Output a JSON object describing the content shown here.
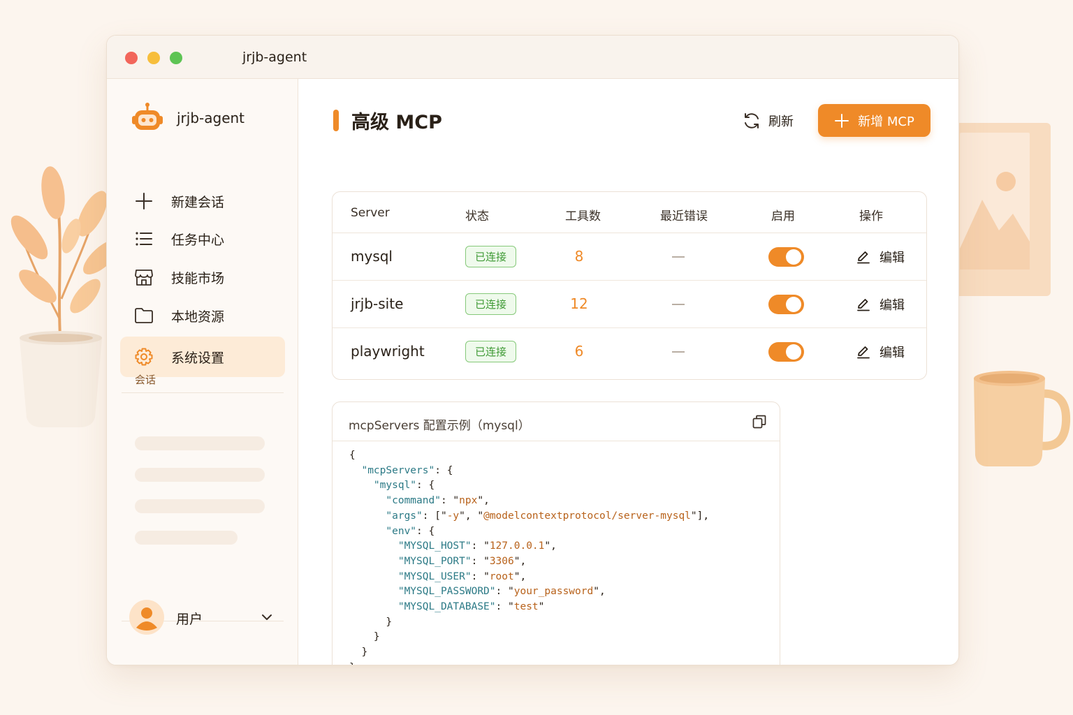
{
  "window": {
    "title": "jrjb-agent"
  },
  "sidebar": {
    "brand": "jrjb-agent",
    "items": [
      {
        "label": "新建会话",
        "icon": "plus-icon"
      },
      {
        "label": "任务中心",
        "icon": "list-icon"
      },
      {
        "label": "技能市场",
        "icon": "store-icon"
      },
      {
        "label": "本地资源",
        "icon": "folder-icon"
      },
      {
        "label": "系统设置",
        "icon": "gear-icon",
        "active": true
      }
    ],
    "section_label": "会话",
    "user": {
      "name": "用户"
    }
  },
  "main": {
    "title": "高级 MCP",
    "refresh_label": "刷新",
    "add_label": "新增 MCP",
    "table": {
      "headers": [
        "Server",
        "状态",
        "工具数",
        "最近错误",
        "启用",
        "操作"
      ],
      "rows": [
        {
          "name": "mysql",
          "status": "已连接",
          "tools": "8",
          "error": "—",
          "enabled": true,
          "action": "编辑"
        },
        {
          "name": "jrjb-site",
          "status": "已连接",
          "tools": "12",
          "error": "—",
          "enabled": true,
          "action": "编辑"
        },
        {
          "name": "playwright",
          "status": "已连接",
          "tools": "6",
          "error": "—",
          "enabled": true,
          "action": "编辑"
        }
      ]
    },
    "config": {
      "title": "mcpServers 配置示例（mysql）",
      "code": {
        "command": "npx",
        "args": [
          "-y",
          "@modelcontextprotocol/server-mysql"
        ],
        "env": {
          "MYSQL_HOST": "127.0.0.1",
          "MYSQL_PORT": "3306",
          "MYSQL_USER": "root",
          "MYSQL_PASSWORD": "your_password",
          "MYSQL_DATABASE": "test"
        }
      }
    }
  },
  "colors": {
    "accent": "#ef8a28",
    "success_text": "#3f9a35",
    "success_border": "#86c97a",
    "active_nav_bg": "#fdebd7",
    "code_key": "#2c7a86",
    "code_string": "#b8621b"
  }
}
